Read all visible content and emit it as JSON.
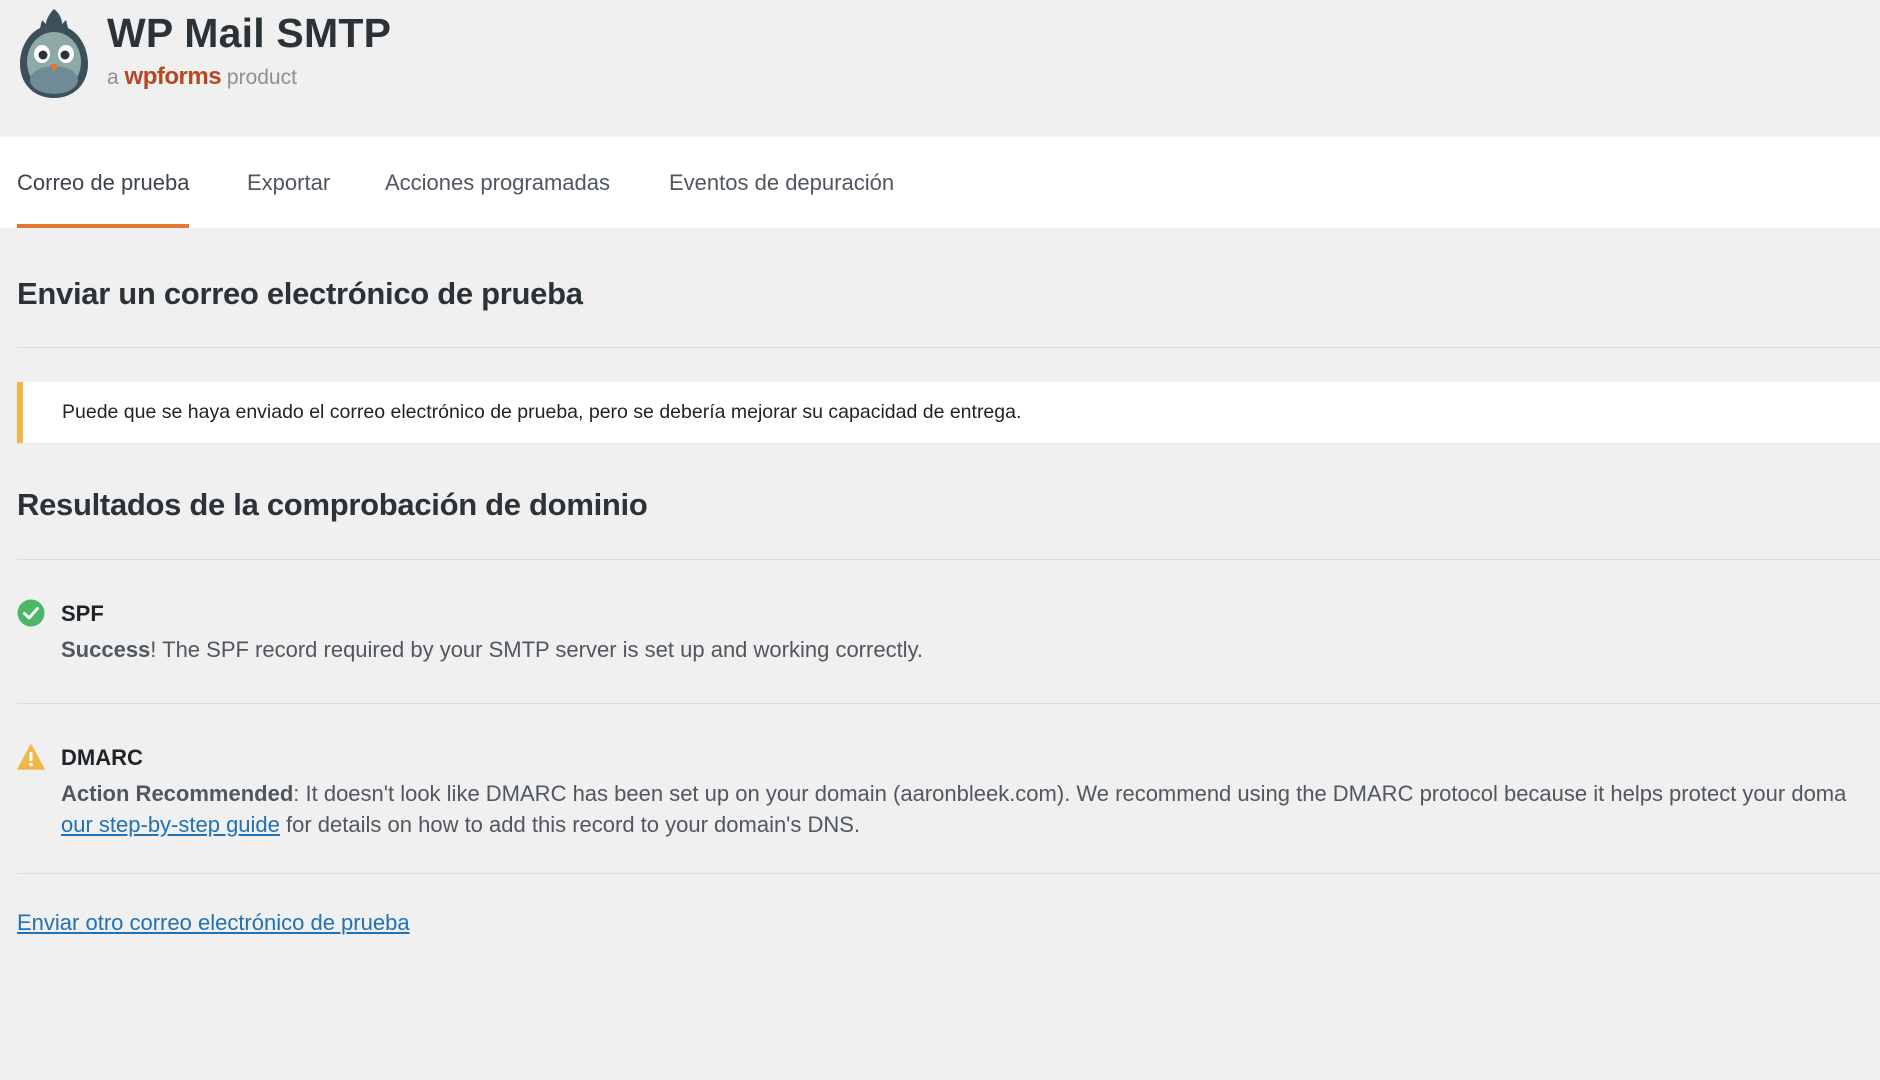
{
  "brand": {
    "title": "WP Mail SMTP",
    "sub_prefix": "a",
    "sub_brand": "wpforms",
    "sub_suffix": "product"
  },
  "tabs": [
    {
      "label": "Correo de prueba",
      "active": true
    },
    {
      "label": "Exportar",
      "active": false
    },
    {
      "label": "Acciones programadas",
      "active": false
    },
    {
      "label": "Eventos de depuración",
      "active": false
    }
  ],
  "main": {
    "title": "Enviar un correo electrónico de prueba",
    "notice": "Puede que se haya enviado el correo electrónico de prueba, pero se debería mejorar su capacidad de entrega.",
    "results_title": "Resultados de la comprobación de dominio",
    "checks": [
      {
        "name": "SPF",
        "status": "success",
        "status_label": "Success",
        "message": "! The SPF record required by your SMTP server is set up and working correctly."
      },
      {
        "name": "DMARC",
        "status": "warning",
        "status_label": "Action Recommended",
        "message": ": It doesn't look like DMARC has been set up on your domain (aaronbleek.com). We recommend using the DMARC protocol because it helps protect your doma",
        "guide_link": "our step-by-step guide",
        "guide_suffix": " for details on how to add this record to your domain's DNS."
      }
    ],
    "send_another_link": "Enviar otro correo electrónico de prueba"
  },
  "colors": {
    "accent": "#e27730",
    "notice_border": "#f0b849",
    "success": "#4ab866",
    "warning": "#f0b849",
    "link": "#2271b1"
  }
}
